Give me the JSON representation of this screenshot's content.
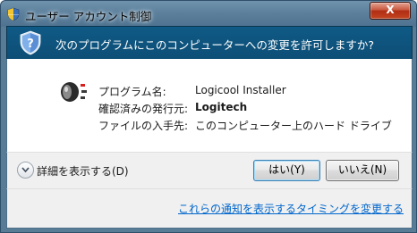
{
  "window": {
    "title": "ユーザー アカウント制御",
    "close_label": "X"
  },
  "header": {
    "question": "次のプログラムにこのコンピューターへの変更を許可しますか?"
  },
  "program": {
    "name_label": "プログラム名:",
    "name_value": "Logicool Installer",
    "publisher_label": "確認済みの発行元:",
    "publisher_value": "Logitech",
    "origin_label": "ファイルの入手先:",
    "origin_value": "このコンピューター上のハード ドライブ"
  },
  "footer": {
    "details_label": "詳細を表示する(D)",
    "yes_label": "はい(Y)",
    "no_label": "いいえ(N)"
  },
  "link": {
    "notification_settings": "これらの通知を表示するタイミングを変更する"
  },
  "colors": {
    "header_band": "#0f5a86",
    "link": "#0066cc",
    "close_button": "#c2441f"
  },
  "icons": {
    "title": "uac-shield-icon",
    "header": "uac-shield-icon",
    "app": "logitech-installer-icon",
    "details": "chevron-down-icon",
    "close": "close-icon"
  }
}
